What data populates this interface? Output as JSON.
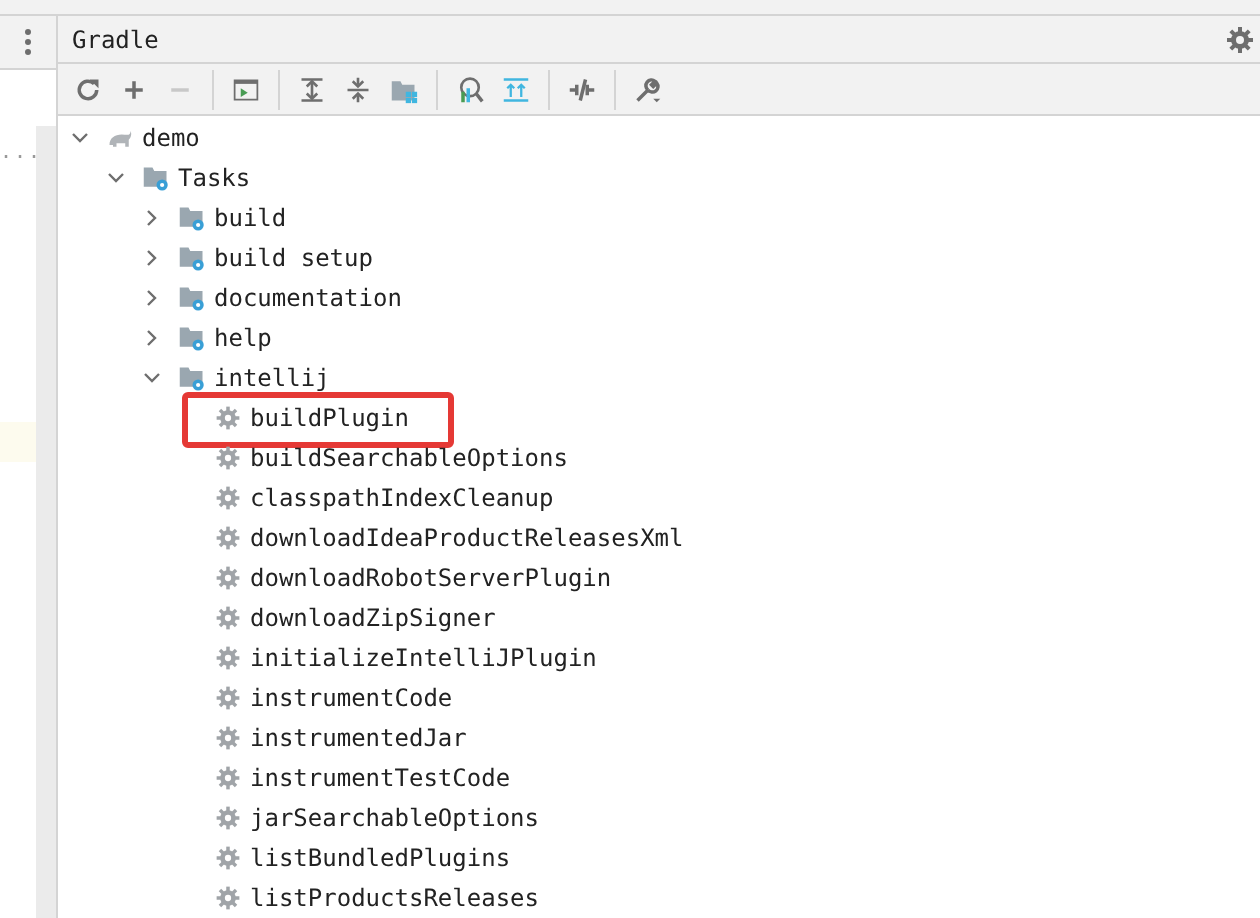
{
  "side_panel": {
    "text": "..."
  },
  "tool_window": {
    "title": "Gradle"
  },
  "toolbar": [
    {
      "kind": "refresh"
    },
    {
      "kind": "plus"
    },
    {
      "kind": "minus",
      "disabled": true
    },
    {
      "kind": "sep"
    },
    {
      "kind": "terminal"
    },
    {
      "kind": "sep"
    },
    {
      "kind": "expand"
    },
    {
      "kind": "collapse"
    },
    {
      "kind": "folder"
    },
    {
      "kind": "sep"
    },
    {
      "kind": "analyze"
    },
    {
      "kind": "align"
    },
    {
      "kind": "sep"
    },
    {
      "kind": "offline"
    },
    {
      "kind": "sep"
    },
    {
      "kind": "wrench"
    }
  ],
  "tree": [
    {
      "name": "demo",
      "kind": "project",
      "expanded": true,
      "children": [
        {
          "name": "Tasks",
          "kind": "folder",
          "expanded": true,
          "children": [
            {
              "name": "build",
              "kind": "folder",
              "expanded": false
            },
            {
              "name": "build setup",
              "kind": "folder",
              "expanded": false
            },
            {
              "name": "documentation",
              "kind": "folder",
              "expanded": false
            },
            {
              "name": "help",
              "kind": "folder",
              "expanded": false
            },
            {
              "name": "intellij",
              "kind": "folder",
              "expanded": true,
              "children": [
                {
                  "name": "buildPlugin",
                  "kind": "task",
                  "highlighted": true
                },
                {
                  "name": "buildSearchableOptions",
                  "kind": "task",
                  "highlighted": false
                },
                {
                  "name": "classpathIndexCleanup",
                  "kind": "task",
                  "highlighted": false
                },
                {
                  "name": "downloadIdeaProductReleasesXml",
                  "kind": "task",
                  "highlighted": false
                },
                {
                  "name": "downloadRobotServerPlugin",
                  "kind": "task",
                  "highlighted": false
                },
                {
                  "name": "downloadZipSigner",
                  "kind": "task",
                  "highlighted": false
                },
                {
                  "name": "initializeIntelliJPlugin",
                  "kind": "task",
                  "highlighted": false
                },
                {
                  "name": "instrumentCode",
                  "kind": "task",
                  "highlighted": false
                },
                {
                  "name": "instrumentedJar",
                  "kind": "task",
                  "highlighted": false
                },
                {
                  "name": "instrumentTestCode",
                  "kind": "task",
                  "highlighted": false
                },
                {
                  "name": "jarSearchableOptions",
                  "kind": "task",
                  "highlighted": false
                },
                {
                  "name": "listBundledPlugins",
                  "kind": "task",
                  "highlighted": false
                },
                {
                  "name": "listProductsReleases",
                  "kind": "task",
                  "highlighted": false
                }
              ]
            }
          ]
        }
      ]
    }
  ]
}
